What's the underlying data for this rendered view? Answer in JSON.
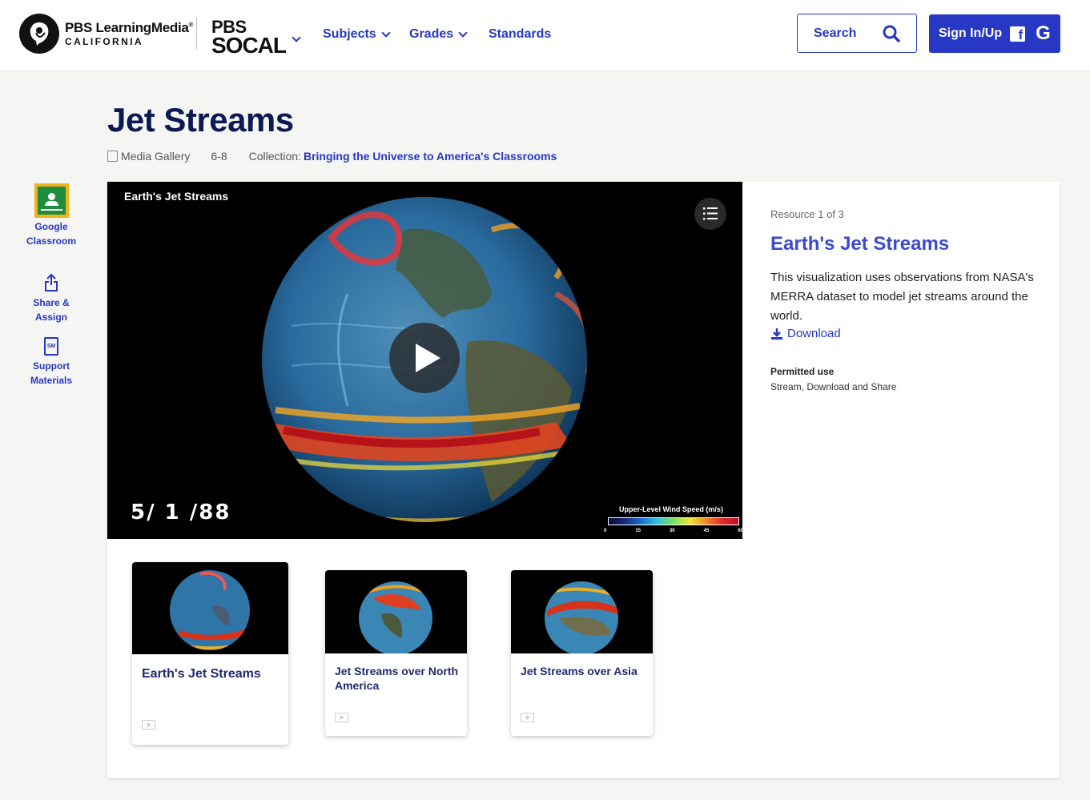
{
  "header": {
    "logo_line1": "PBS LearningMedia",
    "logo_trademark": "®",
    "logo_line2": "CALIFORNIA",
    "station_line1": "PBS",
    "station_line2": "SOCAL",
    "nav": {
      "subjects": "Subjects",
      "grades": "Grades",
      "standards": "Standards"
    },
    "search_label": "Search",
    "signin_label": "Sign In/Up",
    "facebook_glyph": "f",
    "google_glyph": "G"
  },
  "page": {
    "title": "Jet Streams",
    "media_type": "Media Gallery",
    "grades": "6-8",
    "collection_label": "Collection:",
    "collection_name": "Bringing the Universe to America's Classrooms"
  },
  "sidebar": {
    "google_classroom": "Google Classroom",
    "share_assign": "Share & Assign",
    "support_materials": "Support Materials",
    "support_icon_text": "SM"
  },
  "video": {
    "title": "Earth's Jet Streams",
    "date_overlay": "5/ 1 /88",
    "legend_title": "Upper-Level Wind Speed (m/s)",
    "legend_ticks": [
      "0",
      "15",
      "30",
      "45",
      "60"
    ]
  },
  "resource": {
    "count": "Resource 1 of 3",
    "title": "Earth's Jet Streams",
    "description": "This visualization uses observations from NASA's MERRA dataset to model jet streams around the world.",
    "download": "Download",
    "permitted_label": "Permitted use",
    "permitted_value": "Stream, Download and Share"
  },
  "thumbnails": [
    {
      "title": "Earth's Jet Streams"
    },
    {
      "title": "Jet Streams over North America"
    },
    {
      "title": "Jet Streams over Asia"
    }
  ],
  "colors": {
    "brand_blue": "#2638c4",
    "title_navy": "#0c1a54",
    "resource_title": "#3b4bd0",
    "classroom_yellow": "#f3b11b",
    "classroom_green": "#1e8e3e"
  },
  "icons": [
    "pbs-logo-icon",
    "chevron-down-icon",
    "search-icon",
    "facebook-icon",
    "google-icon",
    "media-gallery-icon",
    "google-classroom-icon",
    "share-icon",
    "support-materials-icon",
    "playlist-icon",
    "play-icon",
    "download-icon",
    "video-icon"
  ]
}
